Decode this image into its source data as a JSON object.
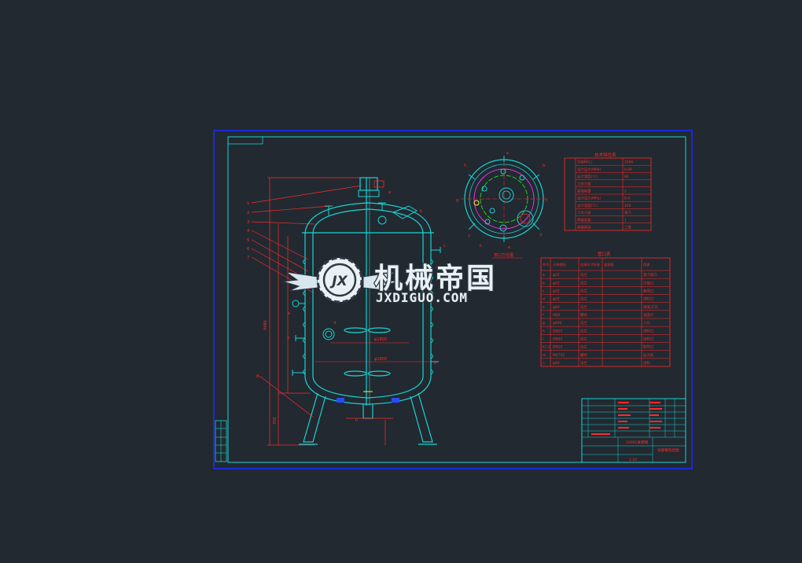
{
  "watermark": {
    "title": "机械帝国",
    "subtitle": "JXDIGUO.COM",
    "emblem": "JX"
  },
  "drawing": {
    "colors": {
      "background": "#222930",
      "outer_border": "#1a2bd6",
      "frame": "#19d3d3",
      "dimension": "#ff2a2a",
      "accent_magenta": "#ff35ff",
      "accent_green": "#22dd22",
      "accent_yellow": "#ffee33",
      "accent_blue": "#2b4bff"
    },
    "part_callouts": [
      "1",
      "2",
      "3",
      "4",
      "5",
      "6",
      "7",
      "8"
    ],
    "dim_labels": {
      "left_total": "4480",
      "left_lower": "700",
      "shell_dia": "φ1800",
      "inner_dia": "φ1600"
    },
    "nozzle_tags": [
      "a",
      "b",
      "c",
      "d",
      "e",
      "f",
      "g",
      "h",
      "i",
      "j",
      "k",
      "l",
      "m"
    ],
    "plan_view_label": "管口方位图",
    "spec_table": {
      "title": "技术特性表",
      "rows": [
        [
          "",
          "全容积(L)",
          "2000"
        ],
        [
          "",
          "设计压力(MPa)",
          "0.09"
        ],
        [
          "",
          "设计温度(℃)",
          "80"
        ],
        [
          "",
          "工作介质",
          ""
        ],
        [
          "",
          "腐蚀裕量",
          "2"
        ],
        [
          "",
          "设计压力(MPa)",
          "0.4"
        ],
        [
          "",
          "设计温度(℃)",
          "100"
        ],
        [
          "",
          "工作介质",
          "蒸汽"
        ],
        [
          "",
          "焊缝系数",
          "1"
        ],
        [
          "",
          "容器类别",
          "二类"
        ]
      ]
    },
    "nozzle_table": {
      "title": "管口表",
      "headers": [
        "符号",
        "公称通径",
        "连接尺寸标准",
        "连接面",
        "用途"
      ],
      "rows": [
        [
          "a",
          "φ25",
          "法兰",
          "",
          "蒸汽进口"
        ],
        [
          "b",
          "φ25",
          "法兰",
          "",
          "冷凝口"
        ],
        [
          "c",
          "φ32",
          "法兰",
          "",
          "备用口"
        ],
        [
          "d",
          "φ25",
          "法兰",
          "",
          "进料口"
        ],
        [
          "e",
          "φ80",
          "法兰",
          "",
          "视镜,灯孔"
        ],
        [
          "f",
          "M20",
          "螺纹",
          "",
          "温度计"
        ],
        [
          "g",
          "φ400",
          "法兰",
          "",
          "人孔"
        ],
        [
          "h",
          "DN25",
          "法兰",
          "",
          "进料口"
        ],
        [
          "i",
          "DN32",
          "法兰",
          "",
          "出料口"
        ],
        [
          "k1-2",
          "DN15",
          "法兰",
          "",
          "取样口"
        ],
        [
          "m",
          "M27X2",
          "螺纹",
          "",
          "压力表"
        ],
        [
          "n",
          "φ40",
          "法兰",
          "",
          "出料"
        ]
      ]
    },
    "title_block": {
      "product": "2000L发酵罐",
      "drawing_name": "发酵罐装配图",
      "scale": "1:10"
    }
  }
}
